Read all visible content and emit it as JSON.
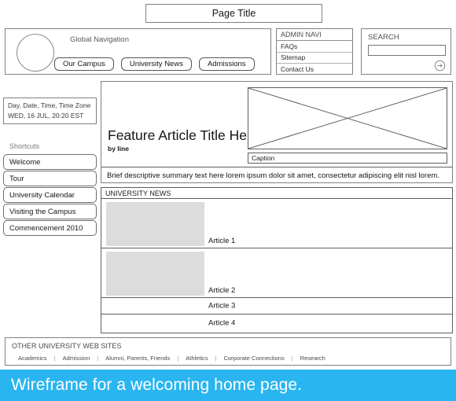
{
  "page_title": {
    "label": "Page Title"
  },
  "global_nav": {
    "label": "Global Navigation",
    "logo_icon": "circle-logo-placeholder",
    "buttons": [
      {
        "label": "Our Campus"
      },
      {
        "label": "University News"
      },
      {
        "label": "Admissions"
      }
    ]
  },
  "admin_navi": {
    "heading": "ADMIN NAVI",
    "items": [
      {
        "label": "FAQs"
      },
      {
        "label": "Sitemap"
      },
      {
        "label": "Contact Us"
      }
    ]
  },
  "search": {
    "heading": "SEARCH",
    "value": "",
    "placeholder": "",
    "go_icon": "arrow-right-circle-icon"
  },
  "date_box": {
    "line1": "Day, Date, Time, Time Zone",
    "line2": "WED, 16 JUL, 20:20 EST"
  },
  "shortcuts": {
    "label": "Shortcuts",
    "items": [
      {
        "label": "Welcome"
      },
      {
        "label": "Tour"
      },
      {
        "label": "University Calendar"
      },
      {
        "label": "Visiting the Campus"
      },
      {
        "label": "Commencement 2010"
      }
    ]
  },
  "feature": {
    "title": "Feature Article Title Here",
    "byline": "by line",
    "image_placeholder_icon": "image-placeholder-cross-icon",
    "caption": "Caption",
    "summary": "Brief descriptive summary text here lorem ipsum dolor sit amet, consectetur adipiscing elit nisl lorem."
  },
  "university_news": {
    "heading": "UNIVERSITY NEWS",
    "rows": [
      {
        "label": "Article 1",
        "has_thumb": true
      },
      {
        "label": "Article 2",
        "has_thumb": true
      },
      {
        "label": "Article 3",
        "has_thumb": false
      },
      {
        "label": "Article 4",
        "has_thumb": false
      }
    ]
  },
  "footer": {
    "heading": "OTHER UNIVERSITY WEB SITES",
    "links": [
      {
        "label": "Academics"
      },
      {
        "label": "Admission"
      },
      {
        "label": "Alumni, Parents, Friends"
      },
      {
        "label": "Athletics"
      },
      {
        "label": "Corporate Connections"
      },
      {
        "label": "Research"
      }
    ],
    "separator": "|"
  },
  "caption_bar": {
    "text": "Wireframe for a welcoming home page.",
    "background_color": "#29b5f0",
    "text_color": "#ffffff"
  },
  "colors": {
    "line": "#5e5e5e",
    "muted_text": "#7a7a7a",
    "thumb_fill": "#dcdcdc",
    "accent": "#29b5f0"
  }
}
